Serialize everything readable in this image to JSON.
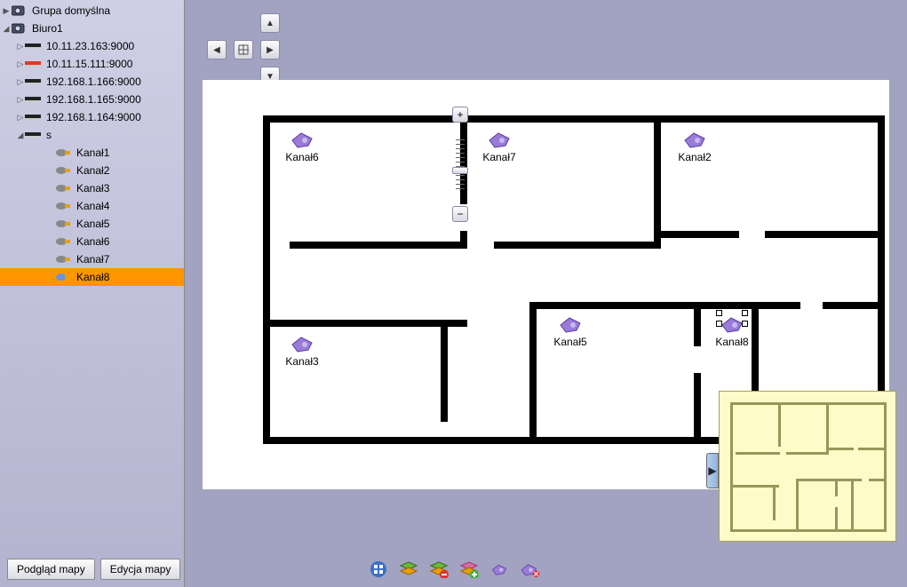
{
  "tree": {
    "root": {
      "label": "Grupa domyślna"
    },
    "group": {
      "label": "Biuro1"
    },
    "devices": [
      {
        "label": "10.11.23.163:9000"
      },
      {
        "label": "10.11.15.111:9000"
      },
      {
        "label": "192.168.1.166:9000"
      },
      {
        "label": "192.168.1.165:9000"
      },
      {
        "label": "192.168.1.164:9000"
      }
    ],
    "folder": {
      "label": "s"
    },
    "channels": [
      {
        "label": "Kanał1"
      },
      {
        "label": "Kanał2"
      },
      {
        "label": "Kanał3"
      },
      {
        "label": "Kanał4"
      },
      {
        "label": "Kanał5"
      },
      {
        "label": "Kanał6"
      },
      {
        "label": "Kanał7"
      },
      {
        "label": "Kanał8",
        "selected": true
      }
    ]
  },
  "map": {
    "cameras": [
      {
        "id": "cam6",
        "label": "Kanał6"
      },
      {
        "id": "cam7",
        "label": "Kanał7"
      },
      {
        "id": "cam2",
        "label": "Kanał2"
      },
      {
        "id": "cam3",
        "label": "Kanał3"
      },
      {
        "id": "cam5",
        "label": "Kanał5"
      },
      {
        "id": "cam8",
        "label": "Kanał8",
        "selected": true
      }
    ]
  },
  "buttons": {
    "preview": "Podgląd mapy",
    "edit": "Edycja mapy"
  }
}
